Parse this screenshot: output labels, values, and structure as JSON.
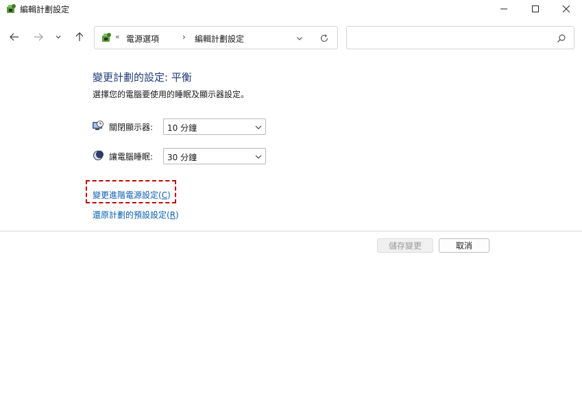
{
  "window": {
    "title": "編輯計劃設定"
  },
  "nav": {
    "address": {
      "overflow_symbol": "«",
      "segments": [
        "電源選項",
        "編輯計劃設定"
      ],
      "separator": "›"
    },
    "search": {
      "value": "",
      "placeholder": ""
    }
  },
  "content": {
    "title": "變更計劃的設定: 平衡",
    "subtitle": "選擇您的電腦要使用的睡眠及顯示器設定。",
    "settings": [
      {
        "label": "關閉顯示器:",
        "value": "10 分鐘",
        "icon": "monitor-clock-icon"
      },
      {
        "label": "讓電腦睡眠:",
        "value": "30 分鐘",
        "icon": "moon-icon"
      }
    ],
    "links": {
      "advanced_text": "變更進階電源設定(",
      "advanced_key": "C",
      "advanced_end": ")",
      "restore_text": "還原計劃的預設設定(",
      "restore_key": "R",
      "restore_end": ")"
    }
  },
  "buttons": {
    "save": "儲存變更",
    "cancel": "取消"
  },
  "colors": {
    "title_blue": "#1e3a78",
    "link_blue": "#0b5fb0",
    "highlight_red": "#c00000"
  }
}
